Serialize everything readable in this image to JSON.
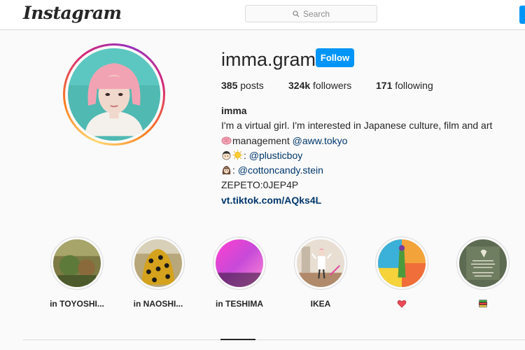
{
  "header": {
    "logo": "Instagram",
    "search_placeholder": "Search"
  },
  "profile": {
    "username": "imma.gram",
    "follow_label": "Follow",
    "stats": {
      "posts_count": "385",
      "posts_label": "posts",
      "followers_count": "324k",
      "followers_label": "followers",
      "following_count": "171",
      "following_label": "following"
    },
    "bio": {
      "name": "imma",
      "line1": "I'm a virtual girl. I'm interested in Japanese culture, film and art",
      "management_label": "management",
      "management_handle": "@aww.tokyo",
      "line3_sep": ":",
      "line3_handle": "@plusticboy",
      "line4_sep": ":",
      "line4_handle": "@cottoncandy.stein",
      "zepeto": "ZEPETO:0JEP4P",
      "link": "vt.tiktok.com/AQks4L"
    }
  },
  "highlights": [
    {
      "label": "in TOYOSHI..."
    },
    {
      "label": "in NAOSHI..."
    },
    {
      "label": "in TESHIMA"
    },
    {
      "label": "IKEA"
    },
    {
      "label": "",
      "icon": "heart-icon"
    },
    {
      "label": "",
      "icon": "book-stack-icon"
    }
  ],
  "colors": {
    "accent": "#0095f6",
    "link": "#00376b",
    "heart": "#ed4956"
  }
}
